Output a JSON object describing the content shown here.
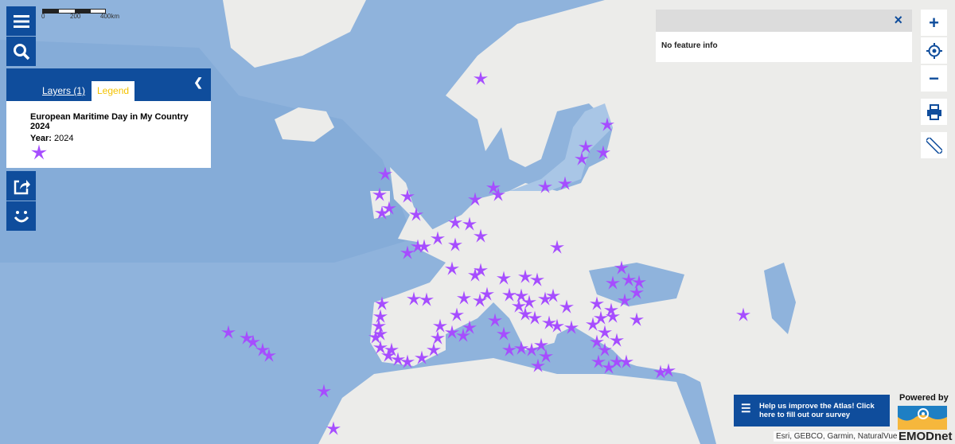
{
  "map": {
    "marker_color": "#a64dff",
    "ocean_color": "#8fb3dc",
    "land_color": "#ececea"
  },
  "scale_bar": {
    "labels": [
      "0",
      "200",
      "400km"
    ]
  },
  "toolbar_left": {
    "menu": "menu-icon",
    "search": "search-icon",
    "share": "share-icon",
    "feedback": "smiley-icon"
  },
  "panel": {
    "tabs": [
      {
        "label": "Layers (1)",
        "active": false
      },
      {
        "label": "Legend",
        "active": true
      }
    ],
    "legend": {
      "title": "European Maritime Day in My Country 2024",
      "year_label": "Year:",
      "year_value": "2024",
      "symbol": "purple-star"
    }
  },
  "info_popup": {
    "text": "No feature info",
    "close": "×"
  },
  "toolbar_right": {
    "zoom_in": "+",
    "zoom_out": "−",
    "locate": "crosshair-icon",
    "print": "print-icon",
    "measure": "ruler-icon"
  },
  "survey": {
    "text": "Help us improve the Atlas! Click here to fill out our survey"
  },
  "branding": {
    "powered_by": "Powered by",
    "name": "EMODnet"
  },
  "attribution": "Esri, GEBCO, Garmin, NaturalVue"
}
